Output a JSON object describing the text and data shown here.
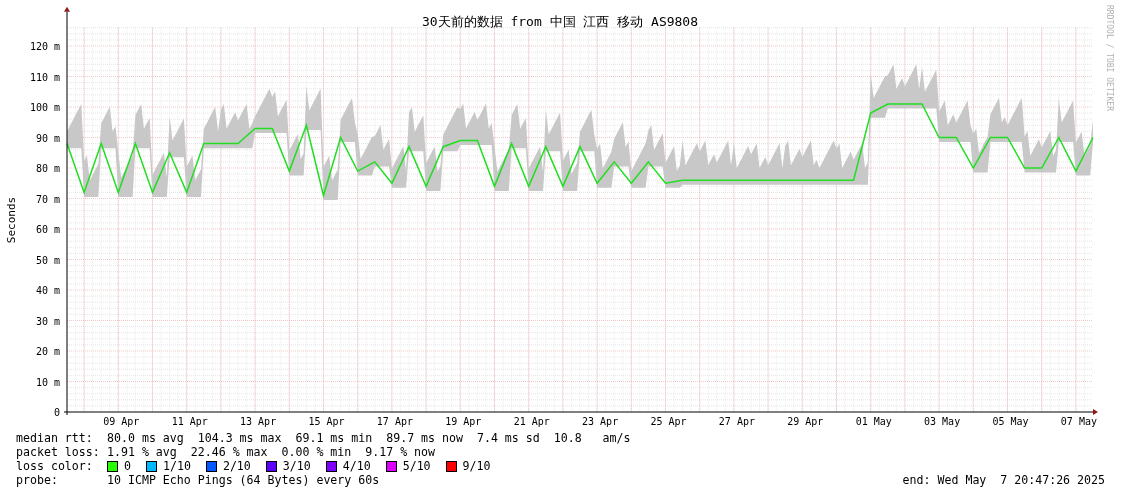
{
  "graph": {
    "side_text": "RRDTOOL / TOBI OETIKER",
    "chart_data": {
      "type": "line",
      "grid": true,
      "title": "30天前的数据 from 中国 江西 移动 AS9808",
      "ylabel": "Seconds",
      "ylim": [
        0,
        126
      ],
      "yticks": [
        {
          "value": 0,
          "label": "0"
        },
        {
          "value": 10,
          "label": "10 m"
        },
        {
          "value": 20,
          "label": "20 m"
        },
        {
          "value": 30,
          "label": "30 m"
        },
        {
          "value": 40,
          "label": "40 m"
        },
        {
          "value": 50,
          "label": "50 m"
        },
        {
          "value": 60,
          "label": "60 m"
        },
        {
          "value": 70,
          "label": "70 m"
        },
        {
          "value": 80,
          "label": "80 m"
        },
        {
          "value": 90,
          "label": "90 m"
        },
        {
          "value": 100,
          "label": "100 m"
        },
        {
          "value": 110,
          "label": "110 m"
        },
        {
          "value": 120,
          "label": "120 m"
        }
      ],
      "categories": [
        null,
        null,
        null,
        "09 Apr",
        null,
        null,
        null,
        "11 Apr",
        null,
        null,
        null,
        "13 Apr",
        null,
        null,
        null,
        "15 Apr",
        null,
        null,
        null,
        "17 Apr",
        null,
        null,
        null,
        "19 Apr",
        null,
        null,
        null,
        "21 Apr",
        null,
        null,
        null,
        "23 Apr",
        null,
        null,
        null,
        "25 Apr",
        null,
        null,
        null,
        "27 Apr",
        null,
        null,
        null,
        "29 Apr",
        null,
        null,
        null,
        "01 May",
        null,
        null,
        null,
        "03 May",
        null,
        null,
        null,
        "05 May",
        null,
        null,
        null,
        "07 May",
        null
      ],
      "series": [
        {
          "color": "#22dd22",
          "values": [
            88,
            72,
            88,
            72,
            88,
            72,
            85,
            72,
            88,
            88,
            88,
            93,
            93,
            79,
            94,
            71,
            90,
            79,
            82,
            75,
            87,
            74,
            87,
            89,
            89,
            74,
            88,
            74,
            87,
            74,
            87,
            75,
            82,
            75,
            82,
            75,
            76,
            76,
            76,
            76,
            76,
            76,
            76,
            76,
            76,
            76,
            76,
            98,
            101,
            101,
            101,
            90,
            90,
            80,
            90,
            90,
            80,
            80,
            90,
            79,
            90
          ]
        }
      ]
    }
  },
  "legend": {
    "rows": [
      {
        "label": "median rtt:",
        "text": "80.0 ms avg  104.3 ms max  69.1 ms min  89.7 ms now  7.4 ms sd  10.8   am/s"
      },
      {
        "label": "packet loss:",
        "text": "1.91 % avg  22.46 % max  0.00 % min  9.17 % now"
      }
    ],
    "loss_colors": {
      "label": "loss color:",
      "items": [
        {
          "label": "0",
          "color": "#26ff00"
        },
        {
          "label": "1/10",
          "color": "#00b8ff"
        },
        {
          "label": "2/10",
          "color": "#0059ff"
        },
        {
          "label": "3/10",
          "color": "#5e00ff"
        },
        {
          "label": "4/10",
          "color": "#7e00ff"
        },
        {
          "label": "5/10",
          "color": "#dd00ff"
        },
        {
          "label": "9/10",
          "color": "#ff0000"
        }
      ]
    },
    "probe": {
      "label": "probe:",
      "text": "10 ICMP Echo Pings (64 Bytes) every 60s"
    },
    "end": "end: Wed May  7 20:47:26 2025"
  }
}
